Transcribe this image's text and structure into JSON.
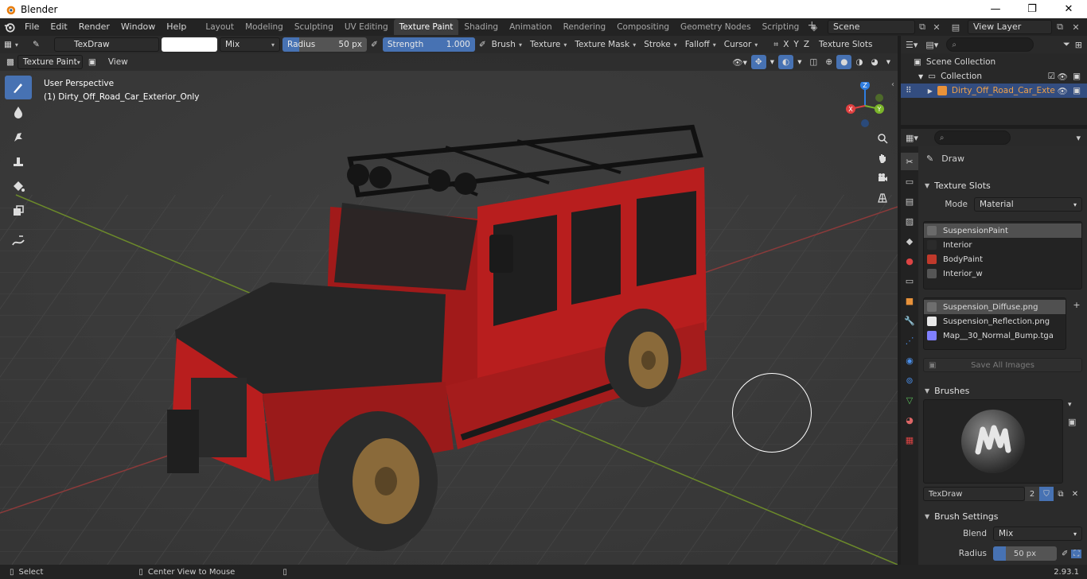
{
  "window": {
    "title": "Blender",
    "minimize": "—",
    "maximize": "❐",
    "close": "✕"
  },
  "menu": [
    "File",
    "Edit",
    "Render",
    "Window",
    "Help"
  ],
  "workspaces": [
    "Layout",
    "Modeling",
    "Sculpting",
    "UV Editing",
    "Texture Paint",
    "Shading",
    "Animation",
    "Rendering",
    "Compositing",
    "Geometry Nodes",
    "Scripting"
  ],
  "active_workspace": "Texture Paint",
  "scene": {
    "name": "Scene",
    "view_layer": "View Layer"
  },
  "tool_header": {
    "brush_name": "TexDraw",
    "blend": "Mix",
    "radius_label": "Radius",
    "radius_value": "50 px",
    "strength_label": "Strength",
    "strength_value": "1.000",
    "strength_fraction": 1.0,
    "radius_fraction": 0.2,
    "menus": [
      "Brush",
      "Texture",
      "Texture Mask",
      "Stroke",
      "Falloff",
      "Cursor"
    ],
    "axes": [
      "X",
      "Y",
      "Z"
    ],
    "texture_slots": "Texture Slots"
  },
  "viewport_header": {
    "mode": "Texture Paint",
    "view": "View"
  },
  "viewport": {
    "perspective": "User Perspective",
    "object_label": "(1) Dirty_Off_Road_Car_Exterior_Only",
    "gizmo": {
      "x": "X",
      "y": "Y",
      "z": "Z"
    }
  },
  "outliner": {
    "scene_collection": "Scene Collection",
    "collection": "Collection",
    "object": "Dirty_Off_Road_Car_Exte"
  },
  "properties": {
    "tool_name": "Draw",
    "texture_slots_title": "Texture Slots",
    "mode_label": "Mode",
    "mode_value": "Material",
    "materials": [
      {
        "name": "SuspensionPaint",
        "color": "#6a6a6a"
      },
      {
        "name": "Interior",
        "color": "#2b2b2b"
      },
      {
        "name": "BodyPaint",
        "color": "#c0392b"
      },
      {
        "name": "Interior_w",
        "color": "#555555"
      }
    ],
    "images": [
      {
        "name": "Suspension_Diffuse.png",
        "color": "#6e6e6e"
      },
      {
        "name": "Suspension_Reflection.png",
        "color": "#e8e8e8"
      },
      {
        "name": "Map__30_Normal_Bump.tga",
        "color": "#8080ff"
      }
    ],
    "save_all": "Save All Images",
    "brushes_title": "Brushes",
    "brush_name": "TexDraw",
    "brush_users": "2",
    "brush_settings_title": "Brush Settings",
    "blend_label": "Blend",
    "blend_value": "Mix",
    "radius_label": "Radius",
    "radius_value": "50 px"
  },
  "status": {
    "select": "Select",
    "center": "Center View to Mouse",
    "version": "2.93.1"
  },
  "colors": {
    "accent": "#4772b3",
    "selected_row": "#334d80",
    "car_red": "#b81e1e"
  }
}
